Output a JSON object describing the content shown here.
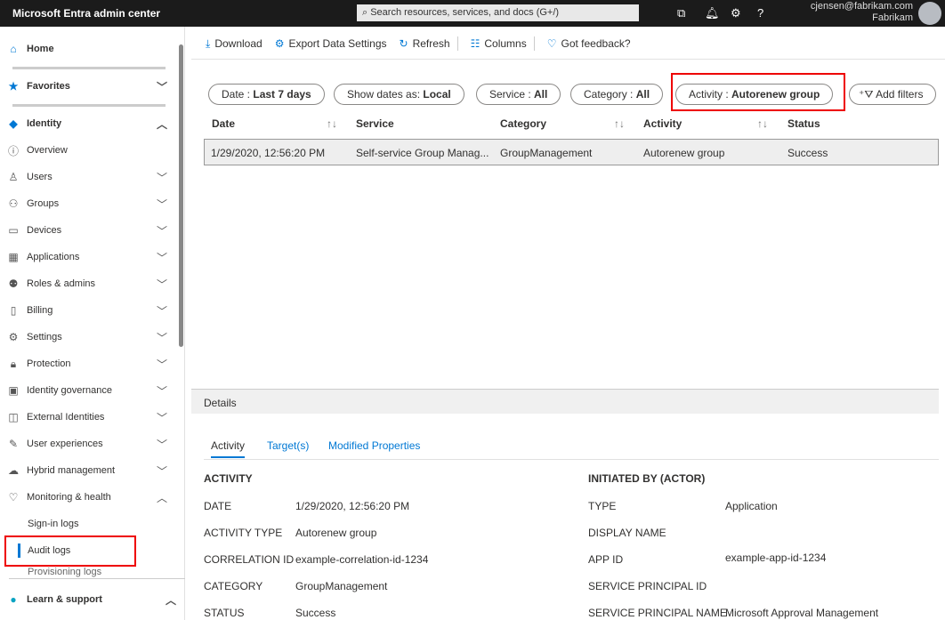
{
  "header": {
    "title": "Microsoft Entra admin center",
    "search_placeholder": "Search resources, services, and docs (G+/)",
    "user_email": "cjensen@fabrikam.com",
    "tenant": "Fabrikam"
  },
  "sidebar": {
    "home": "Home",
    "favorites": "Favorites",
    "identity": "Identity",
    "items": [
      {
        "label": "Overview",
        "icon": "info-icon"
      },
      {
        "label": "Users",
        "icon": "user-icon",
        "chevron": "down"
      },
      {
        "label": "Groups",
        "icon": "groups-icon",
        "chevron": "down"
      },
      {
        "label": "Devices",
        "icon": "devices-icon",
        "chevron": "down"
      },
      {
        "label": "Applications",
        "icon": "applications-icon",
        "chevron": "down"
      },
      {
        "label": "Roles & admins",
        "icon": "roles-icon",
        "chevron": "down"
      },
      {
        "label": "Billing",
        "icon": "billing-icon",
        "chevron": "down"
      },
      {
        "label": "Settings",
        "icon": "gear-icon",
        "chevron": "down"
      },
      {
        "label": "Protection",
        "icon": "lock-icon",
        "chevron": "down"
      },
      {
        "label": "Identity governance",
        "icon": "governance-icon",
        "chevron": "down"
      },
      {
        "label": "External Identities",
        "icon": "external-identities-icon",
        "chevron": "down"
      },
      {
        "label": "User experiences",
        "icon": "user-experiences-icon",
        "chevron": "down"
      },
      {
        "label": "Hybrid management",
        "icon": "cloud-sync-icon",
        "chevron": "down"
      },
      {
        "label": "Monitoring & health",
        "icon": "heart-monitor-icon",
        "chevron": "up"
      }
    ],
    "sub_items": [
      "Sign-in logs",
      "Audit logs",
      "Provisioning logs"
    ],
    "active": "Audit logs",
    "learn": "Learn & support"
  },
  "toolbar": {
    "download": "Download",
    "export": "Export Data Settings",
    "refresh": "Refresh",
    "columns": "Columns",
    "feedback": "Got feedback?"
  },
  "filters": [
    {
      "label": "Date : ",
      "value": "Last 7 days"
    },
    {
      "label": "Show dates as: ",
      "value": "Local"
    },
    {
      "label": "Service : ",
      "value": "All"
    },
    {
      "label": "Category : ",
      "value": "All"
    },
    {
      "label": "Activity : ",
      "value": "Autorenew group"
    }
  ],
  "add_filters": "Add filters",
  "table": {
    "columns": [
      "Date",
      "Service",
      "Category",
      "Activity",
      "Status"
    ],
    "rows": [
      [
        "1/29/2020, 12:56:20 PM",
        "Self-service Group Manag...",
        "GroupManagement",
        "Autorenew group",
        "Success"
      ]
    ]
  },
  "details": {
    "title": "Details",
    "tabs": [
      "Activity",
      "Target(s)",
      "Modified Properties"
    ],
    "activity_heading": "ACTIVITY",
    "activity": [
      [
        "DATE",
        "1/29/2020, 12:56:20 PM"
      ],
      [
        "ACTIVITY TYPE",
        "Autorenew group"
      ],
      [
        "CORRELATION ID",
        "example-correlation-id-1234"
      ],
      [
        "CATEGORY",
        "GroupManagement"
      ],
      [
        "STATUS",
        "Success"
      ]
    ],
    "actor_heading": "INITIATED BY (ACTOR)",
    "actor": [
      [
        "TYPE",
        "Application"
      ],
      [
        "DISPLAY NAME",
        ""
      ],
      [
        "APP ID",
        "example-app-id-1234"
      ],
      [
        "SERVICE PRINCIPAL ID",
        ""
      ],
      [
        "SERVICE PRINCIPAL NAME",
        "Microsoft Approval Management"
      ]
    ]
  },
  "colors": {
    "accent": "#0078d4",
    "topbar": "#1b1b1b",
    "highlight": "#e00000"
  }
}
